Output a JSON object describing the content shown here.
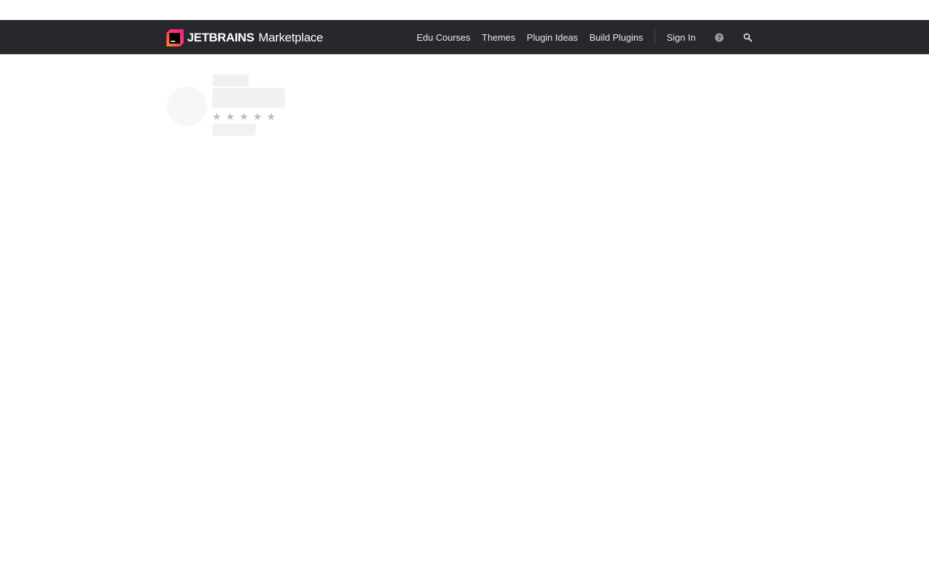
{
  "brand": {
    "name": "JETBRAINS",
    "product": "Marketplace"
  },
  "nav": {
    "links": [
      {
        "label": "Edu Courses"
      },
      {
        "label": "Themes"
      },
      {
        "label": "Plugin Ideas"
      },
      {
        "label": "Build Plugins"
      }
    ],
    "signin": "Sign In",
    "help_icon": "help-circle-icon",
    "search_icon": "search-icon"
  },
  "loading_card": {
    "rating_stars": [
      "★",
      "★",
      "★",
      "★",
      "★"
    ]
  },
  "colors": {
    "navbar": "#27282c",
    "logo_pink": "#ff1a8c",
    "logo_orange": "#ff8a1f",
    "skeleton": "#f1f1f2"
  }
}
